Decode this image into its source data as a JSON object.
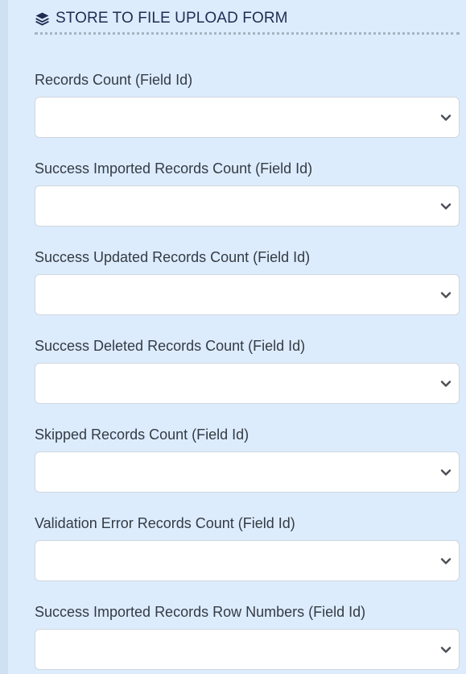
{
  "section": {
    "title": "STORE TO FILE UPLOAD FORM",
    "icon": "layers-icon"
  },
  "fields": [
    {
      "label": "Records Count (Field Id)",
      "value": ""
    },
    {
      "label": "Success Imported Records Count (Field Id)",
      "value": ""
    },
    {
      "label": "Success Updated Records Count (Field Id)",
      "value": ""
    },
    {
      "label": "Success Deleted Records Count (Field Id)",
      "value": ""
    },
    {
      "label": "Skipped Records Count (Field Id)",
      "value": ""
    },
    {
      "label": "Validation Error Records Count (Field Id)",
      "value": ""
    },
    {
      "label": "Success Imported Records Row Numbers (Field Id)",
      "value": ""
    }
  ],
  "colors": {
    "panel_background": "#ddecfc",
    "title_text": "#1f2d52",
    "label_text": "#333b45",
    "select_background": "#ffffff",
    "select_border": "#cfd6de",
    "chevron": "#4a4f55"
  }
}
